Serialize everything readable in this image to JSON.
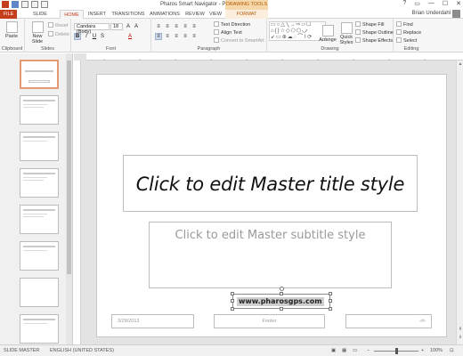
{
  "window": {
    "title": "Pharos Smart Navigator - PowerPoint",
    "context_title": "DRAWING TOOLS",
    "controls": [
      "?",
      "▭",
      "—",
      "☐",
      "✕"
    ],
    "user": "Brian Underdahl"
  },
  "tabs": [
    {
      "label": "FILE"
    },
    {
      "label": "SLIDE MASTER"
    },
    {
      "label": "HOME"
    },
    {
      "label": "INSERT"
    },
    {
      "label": "TRANSITIONS"
    },
    {
      "label": "ANIMATIONS"
    },
    {
      "label": "REVIEW"
    },
    {
      "label": "VIEW"
    },
    {
      "label": "FORMAT"
    }
  ],
  "ribbon": {
    "clipboard": {
      "label": "Clipboard",
      "paste": "Paste"
    },
    "slides": {
      "label": "Slides",
      "new_slide": "New Slide",
      "reset": "Reset",
      "delete": "Delete"
    },
    "font": {
      "label": "Font",
      "name": "Candara (Body)",
      "size": "18",
      "bold": "B",
      "italic": "I",
      "underline": "U",
      "strike": "S",
      "color": "A"
    },
    "paragraph": {
      "label": "Paragraph",
      "text_direction": "Text Direction",
      "align_text": "Align Text",
      "smartart": "Convert to SmartArt"
    },
    "drawing": {
      "label": "Drawing",
      "arrange": "Arrange",
      "quick_styles": "Quick Styles",
      "shape_fill": "Shape Fill",
      "shape_outline": "Shape Outline",
      "shape_effects": "Shape Effects"
    },
    "editing": {
      "label": "Editing",
      "find": "Find",
      "replace": "Replace",
      "select": "Select"
    }
  },
  "slide": {
    "title": "Click to edit Master title style",
    "subtitle": "Click to edit Master subtitle style",
    "date": "3/29/2013",
    "footer": "Footer",
    "number": "‹#›",
    "website": "www.pharosgps.com"
  },
  "status": {
    "view": "SLIDE MASTER",
    "language": "ENGLISH (UNITED STATES)",
    "zoom": "100%"
  }
}
